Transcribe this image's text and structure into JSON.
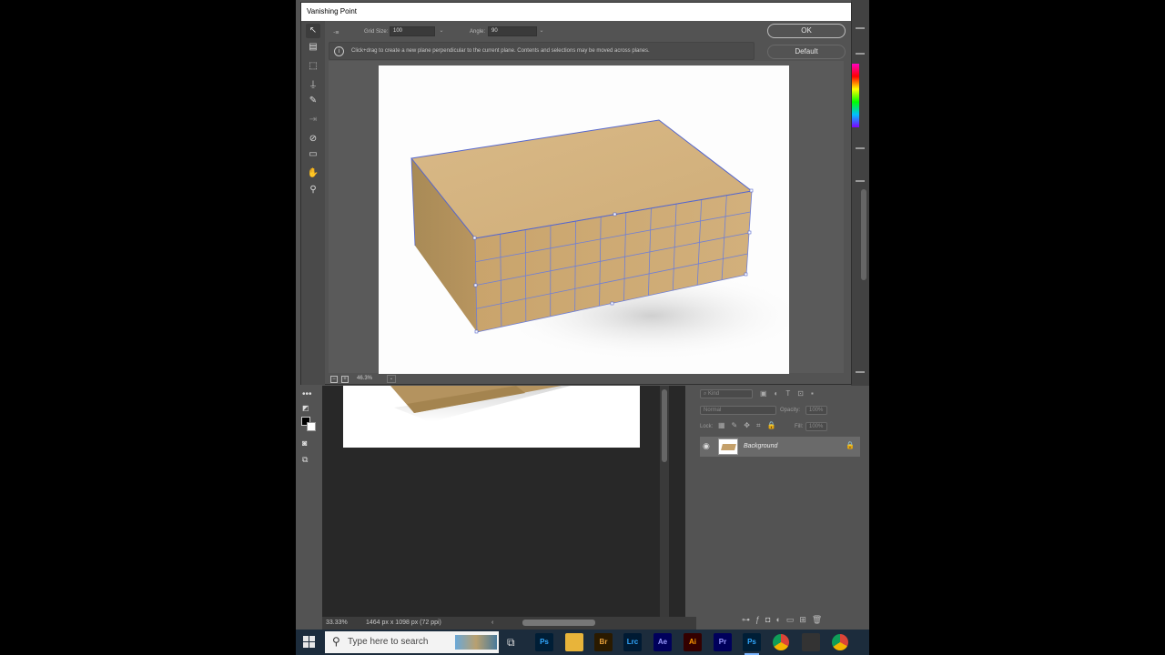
{
  "dialog": {
    "title": "Vanishing Point",
    "grid_size_label": "Grid Size:",
    "grid_size_value": "100",
    "angle_label": "Angle:",
    "angle_value": "90",
    "info_message": "Click+drag to create a new plane perpendicular to the current plane. Contents and selections may be moved across planes.",
    "ok_label": "OK",
    "default_label": "Default",
    "zoom_level": "46.3%"
  },
  "photoshop": {
    "status_zoom": "33.33%",
    "status_doc_info": "1464 px x 1098 px (72 ppi)",
    "layers": {
      "kind_label": "Kind",
      "blend_mode": "Normal",
      "opacity_label": "Opacity:",
      "opacity_value": "100%",
      "lock_label": "Lock:",
      "fill_label": "Fill:",
      "fill_value": "100%",
      "layer_name": "Background"
    }
  },
  "taskbar": {
    "search_placeholder": "Type here to search",
    "apps": [
      {
        "name": "ps",
        "label": "Ps",
        "bg": "#001e36",
        "fg": "#31a8ff"
      },
      {
        "name": "file-explorer",
        "label": "",
        "bg": "#e8b43a",
        "fg": "#e8b43a"
      },
      {
        "name": "br",
        "label": "Br",
        "bg": "#2a1a00",
        "fg": "#e8a03a"
      },
      {
        "name": "lrc",
        "label": "Lrc",
        "bg": "#001a33",
        "fg": "#31a8ff"
      },
      {
        "name": "ae",
        "label": "Ae",
        "bg": "#00005b",
        "fg": "#9999ff"
      },
      {
        "name": "pr",
        "label": "Pr",
        "bg": "#00005b",
        "fg": "#9999ff"
      },
      {
        "name": "ai",
        "label": "Ai",
        "bg": "#330000",
        "fg": "#ff9a00"
      },
      {
        "name": "ps-active",
        "label": "Ps",
        "bg": "#001e36",
        "fg": "#31a8ff"
      },
      {
        "name": "chrome",
        "label": "",
        "bg": "#db4437",
        "fg": "#ffffff"
      },
      {
        "name": "camera",
        "label": "",
        "bg": "#333333",
        "fg": "#ffffff"
      },
      {
        "name": "chrome-2",
        "label": "",
        "bg": "#db4437",
        "fg": "#ffffff"
      }
    ]
  }
}
